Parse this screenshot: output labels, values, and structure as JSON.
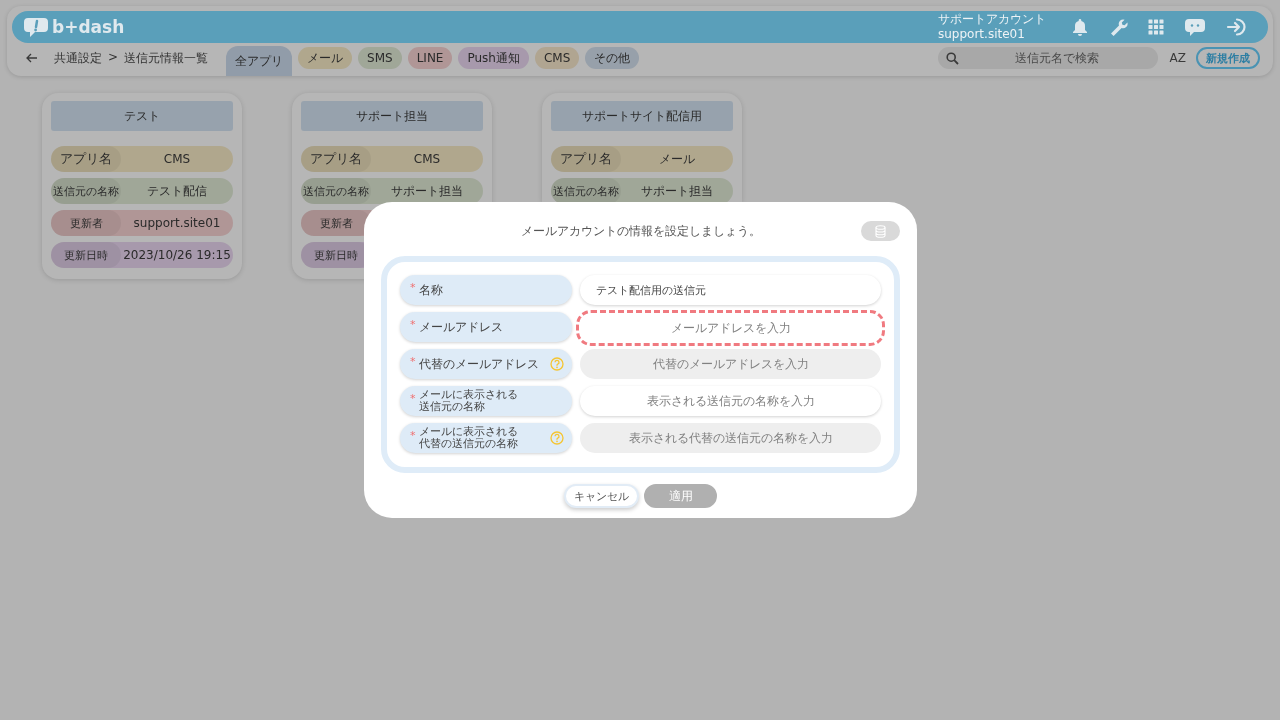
{
  "app": {
    "logo": "b+dash"
  },
  "account": {
    "name": "サポートアカウント",
    "id": "support.site01"
  },
  "breadcrumb": [
    "共通設定",
    ">",
    "送信元情報一覧"
  ],
  "tabs": [
    {
      "label": "全アプリ",
      "selected": true,
      "color": "#919ca9"
    },
    {
      "label": "メール",
      "selected": false,
      "color": "#b0a78d"
    },
    {
      "label": "SMS",
      "selected": false,
      "color": "#a0a798"
    },
    {
      "label": "LINE",
      "selected": false,
      "color": "#b09696"
    },
    {
      "label": "Push通知",
      "selected": false,
      "color": "#a799ac"
    },
    {
      "label": "CMS",
      "selected": false,
      "color": "#b0a591"
    },
    {
      "label": "その他",
      "selected": false,
      "color": "#97a0aa"
    }
  ],
  "search": {
    "placeholder": "送信元名で検索"
  },
  "sort_label": "AZ",
  "new_button": "新規作成",
  "cards": [
    {
      "title": "テスト",
      "rows": [
        {
          "label": "アプリ名",
          "value": "CMS",
          "color": "#b0a78d"
        },
        {
          "label": "送信元の名称",
          "value": "テスト配信",
          "color": "#a0a798"
        },
        {
          "label": "更新者",
          "value": "support.site01",
          "color": "#b09696"
        },
        {
          "label": "更新日時",
          "value": "2023/10/26 19:15",
          "color": "#a799ac"
        }
      ]
    },
    {
      "title": "サポート担当",
      "rows": [
        {
          "label": "アプリ名",
          "value": "CMS",
          "color": "#b0a78d"
        },
        {
          "label": "送信元の名称",
          "value": "サポート担当",
          "color": "#a0a798"
        },
        {
          "label": "更新者",
          "color": "#b09696"
        },
        {
          "label": "更新日時",
          "color": "#a799ac"
        }
      ]
    },
    {
      "title": "サポートサイト配信用",
      "rows": [
        {
          "label": "アプリ名",
          "value": "メール",
          "color": "#b0a78d"
        },
        {
          "label": "送信元の名称",
          "value": "サポート担当",
          "color": "#a0a798"
        }
      ]
    }
  ],
  "dialog": {
    "title": "メールアカウントの情報を設定しましょう。",
    "required_mark": "*",
    "fields": [
      {
        "label": [
          "名称"
        ],
        "required": true,
        "help": false,
        "value": "テスト配信用の送信元",
        "disabled": false,
        "invalid": false
      },
      {
        "label": [
          "メールアドレス"
        ],
        "required": true,
        "help": false,
        "placeholder": "メールアドレスを入力",
        "disabled": false,
        "invalid": true
      },
      {
        "label": [
          "代替のメールアドレス"
        ],
        "required": true,
        "help": true,
        "placeholder": "代替のメールアドレスを入力",
        "disabled": true,
        "invalid": false
      },
      {
        "label": [
          "メールに表示される",
          "送信元の名称"
        ],
        "required": true,
        "help": false,
        "placeholder": "表示される送信元の名称を入力",
        "disabled": false,
        "invalid": false
      },
      {
        "label": [
          "メールに表示される",
          "代替の送信元の名称"
        ],
        "required": true,
        "help": true,
        "placeholder": "表示される代替の送信元の名称を入力",
        "disabled": true,
        "invalid": false
      }
    ],
    "buttons": [
      {
        "label": "キャンセル",
        "disabled": false
      },
      {
        "label": "適用",
        "disabled": true
      }
    ]
  }
}
